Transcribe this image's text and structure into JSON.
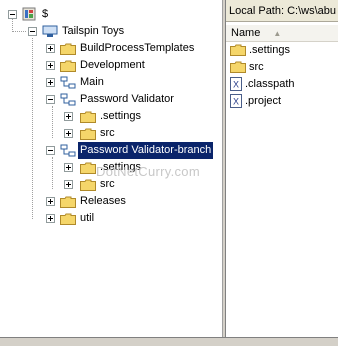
{
  "tree": {
    "root_label": "$",
    "project_label": "Tailspin Toys",
    "items": [
      {
        "label": "BuildProcessTemplates"
      },
      {
        "label": "Development"
      },
      {
        "label": "Main"
      },
      {
        "label": "Password Validator"
      },
      {
        "label": ".settings"
      },
      {
        "label": "src"
      },
      {
        "label": "Password Validator-branch"
      },
      {
        "label": ".settings"
      },
      {
        "label": "src"
      },
      {
        "label": "Releases"
      },
      {
        "label": "util"
      }
    ]
  },
  "right_pane": {
    "local_path": "Local Path: C:\\ws\\abu",
    "column_name": "Name",
    "files": [
      {
        "name": ".settings",
        "icon": "folder-icon"
      },
      {
        "name": "src",
        "icon": "folder-icon"
      },
      {
        "name": ".classpath",
        "icon": "xml-file-icon"
      },
      {
        "name": ".project",
        "icon": "xml-file-icon"
      }
    ]
  },
  "watermark": "DotNetCurry.com",
  "colors": {
    "selection": "#0a246a",
    "folder": "#f5d66a"
  }
}
